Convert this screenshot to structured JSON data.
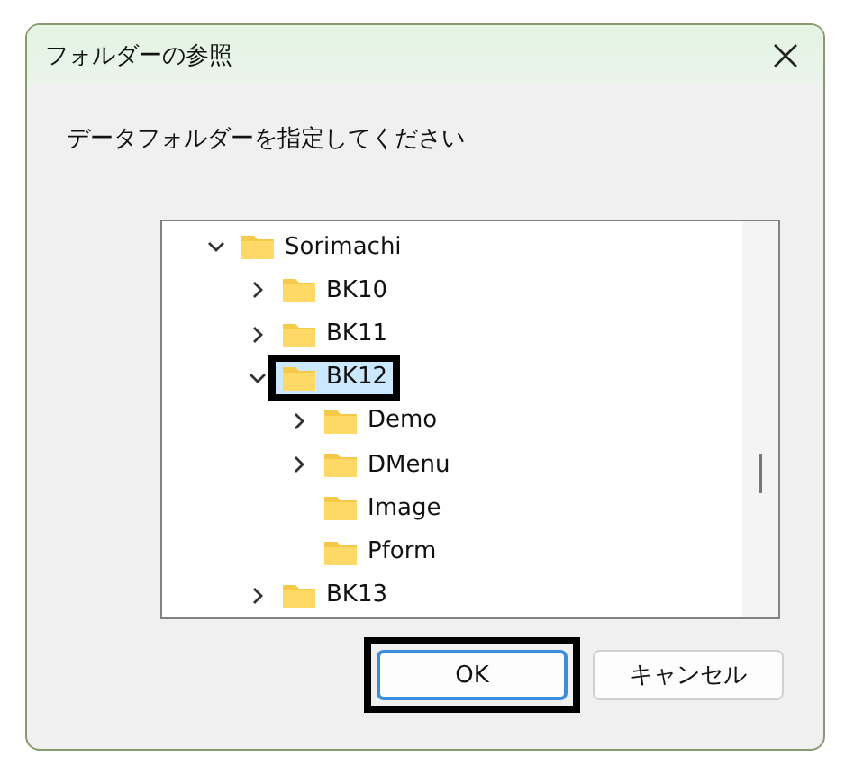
{
  "window": {
    "title": "フォルダーの参照"
  },
  "instruction": "データフォルダーを指定してください",
  "tree": [
    {
      "label": "Sorimachi",
      "expanded": true,
      "selected": false,
      "highlighted": false,
      "children": [
        {
          "label": "BK10",
          "expanded": false,
          "selected": false,
          "highlighted": false
        },
        {
          "label": "BK11",
          "expanded": false,
          "selected": false,
          "highlighted": false
        },
        {
          "label": "BK12",
          "expanded": true,
          "selected": true,
          "highlighted": true,
          "children": [
            {
              "label": "Demo",
              "expanded": false,
              "selected": false,
              "highlighted": false
            },
            {
              "label": "DMenu",
              "expanded": false,
              "selected": false,
              "highlighted": false
            },
            {
              "label": "Image",
              "selected": false,
              "highlighted": false
            },
            {
              "label": "Pform",
              "selected": false,
              "highlighted": false
            }
          ]
        },
        {
          "label": "BK13",
          "expanded": false,
          "selected": false,
          "highlighted": false
        }
      ]
    }
  ],
  "buttons": [
    {
      "label": "OK",
      "default": true,
      "highlighted": true
    },
    {
      "label": "キャンセル",
      "default": false,
      "highlighted": false
    }
  ]
}
